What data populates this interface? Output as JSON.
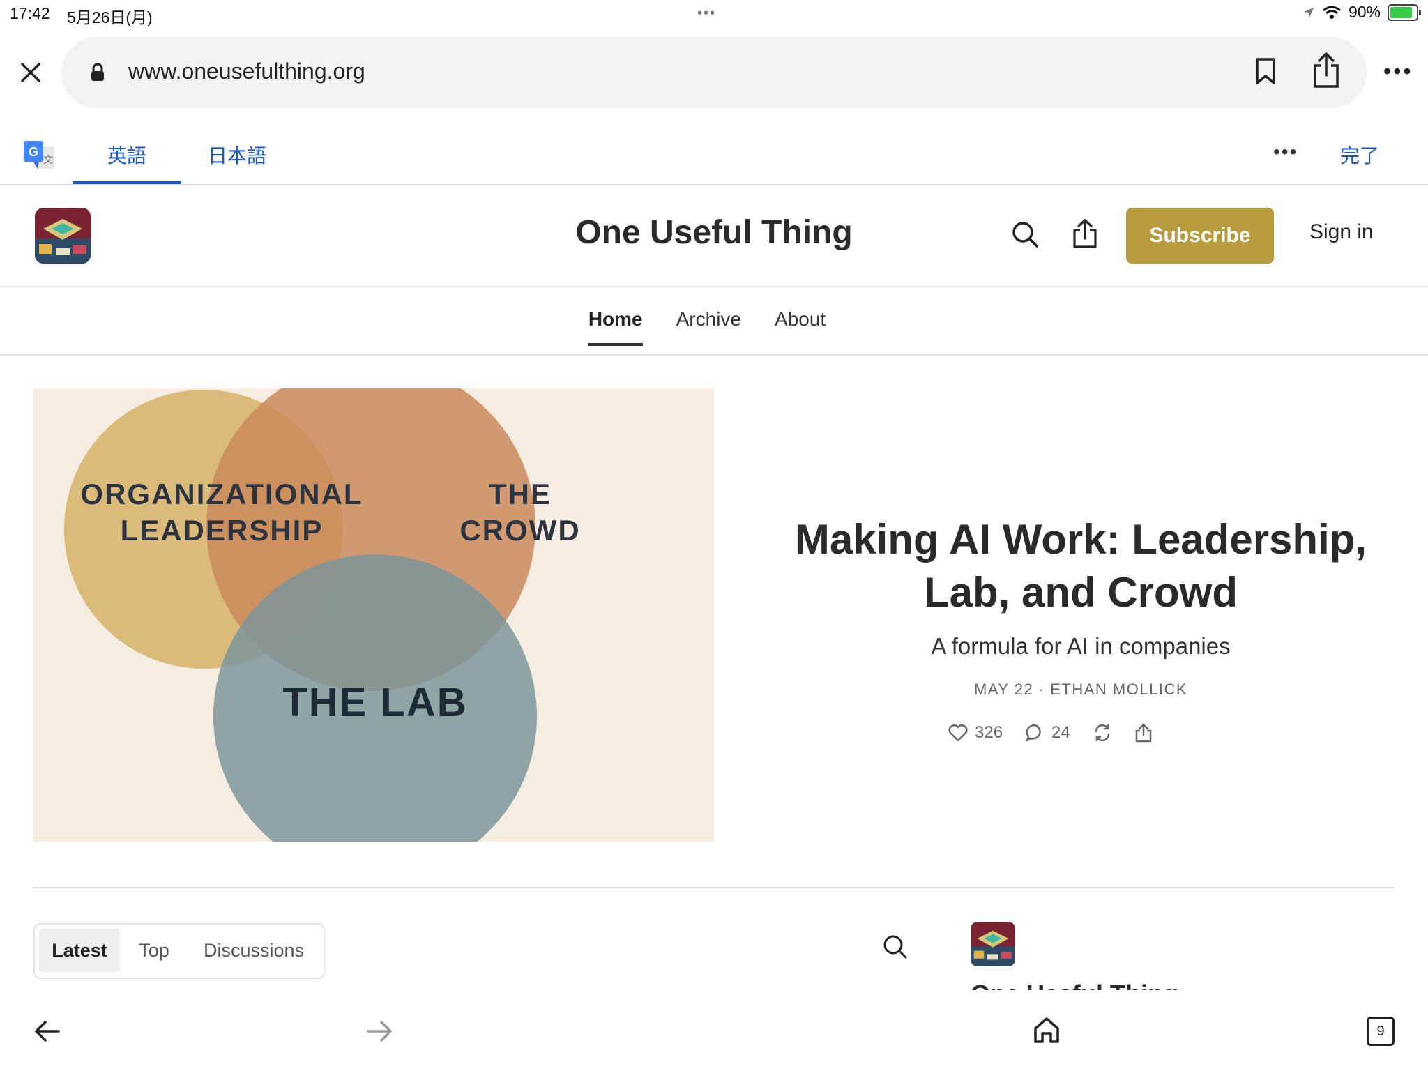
{
  "status_bar": {
    "time": "17:42",
    "date": "5月26日(月)",
    "battery": "90%",
    "battery_level": 0.9
  },
  "browser": {
    "url": "www.oneusefulthing.org",
    "tab_count": "9"
  },
  "translate_bar": {
    "source_language": "英語",
    "target_language": "日本語",
    "done_label": "完了"
  },
  "site": {
    "title": "One Useful Thing",
    "subscribe_label": "Subscribe",
    "signin_label": "Sign in",
    "nav": [
      {
        "label": "Home"
      },
      {
        "label": "Archive"
      },
      {
        "label": "About"
      }
    ]
  },
  "hero": {
    "image": {
      "circle_org": "ORGANIZATIONAL LEADERSHIP",
      "circle_crowd": "THE CROWD",
      "circle_lab": "THE LAB"
    },
    "title": "Making AI Work: Leadership, Lab, and Crowd",
    "subtitle": "A formula for AI in companies",
    "meta": "MAY 22 · ETHAN MOLLICK",
    "likes": "326",
    "comments": "24"
  },
  "feed": {
    "tabs": [
      "Latest",
      "Top",
      "Discussions"
    ],
    "side_title": "One Useful Thing"
  },
  "colors": {
    "accent_subscribe": "#b89b3f",
    "translate_blue": "#1a55c9",
    "circle_yellow": "#d7b56f",
    "circle_orange": "#c98a5a",
    "circle_blue": "#7e959a"
  }
}
